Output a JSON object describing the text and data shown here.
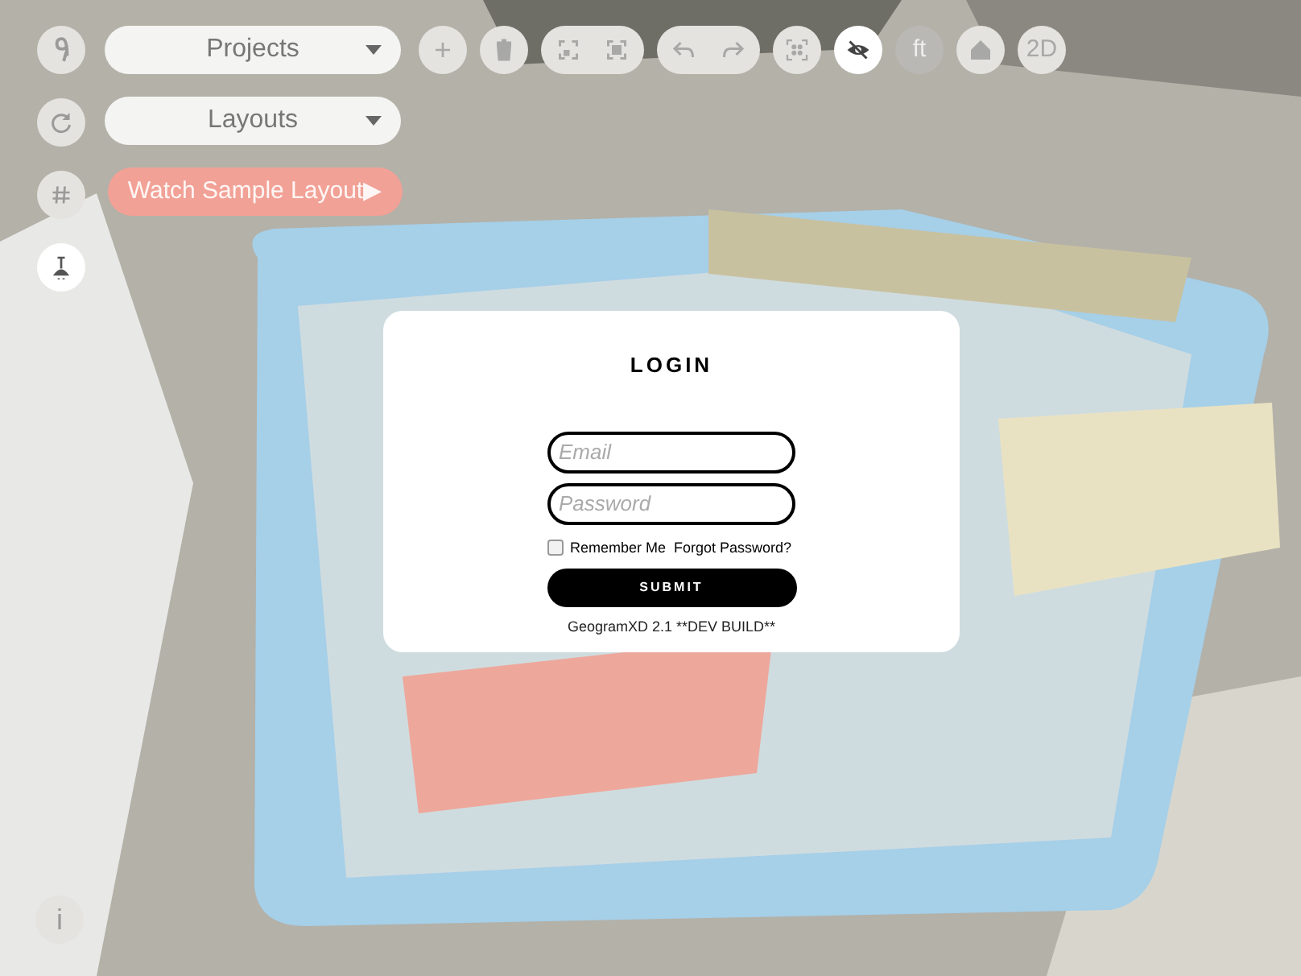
{
  "side_buttons": [
    {
      "kind": "nine",
      "active": false
    },
    {
      "kind": "refresh",
      "active": false
    },
    {
      "kind": "hash",
      "active": false
    },
    {
      "kind": "lamp",
      "active": true
    }
  ],
  "dropdowns": [
    {
      "label": "Projects"
    },
    {
      "label": "Layouts"
    }
  ],
  "sample_button": {
    "label": "Watch Sample Layout▶"
  },
  "toolbar": [
    {
      "group": [
        {
          "kind": "plus",
          "active": false
        }
      ]
    },
    {
      "group": [
        {
          "kind": "trash",
          "active": false
        }
      ]
    },
    {
      "group": [
        {
          "kind": "fit",
          "active": false
        },
        {
          "kind": "focus",
          "active": false
        }
      ]
    },
    {
      "group": [
        {
          "kind": "undo",
          "active": false
        },
        {
          "kind": "redo",
          "active": false
        }
      ]
    },
    {
      "group": [
        {
          "kind": "grid",
          "active": false
        }
      ]
    },
    {
      "group": [
        {
          "kind": "hide",
          "active": true
        }
      ]
    },
    {
      "group": [
        {
          "text": "ft",
          "active": false,
          "dark": true
        }
      ]
    },
    {
      "group": [
        {
          "kind": "home",
          "active": false
        }
      ]
    },
    {
      "group": [
        {
          "text": "2D",
          "active": false
        }
      ]
    }
  ],
  "login": {
    "title": "LOGIN",
    "email": {
      "placeholder": "Email"
    },
    "password": {
      "placeholder": "Password"
    },
    "remember": {
      "label": "Remember Me",
      "checked": false
    },
    "forgot": "Forgot Password?",
    "submit": "SUBMIT",
    "version": "GeogramXD 2.1 **DEV BUILD**"
  },
  "info_button": {
    "text": "i"
  }
}
